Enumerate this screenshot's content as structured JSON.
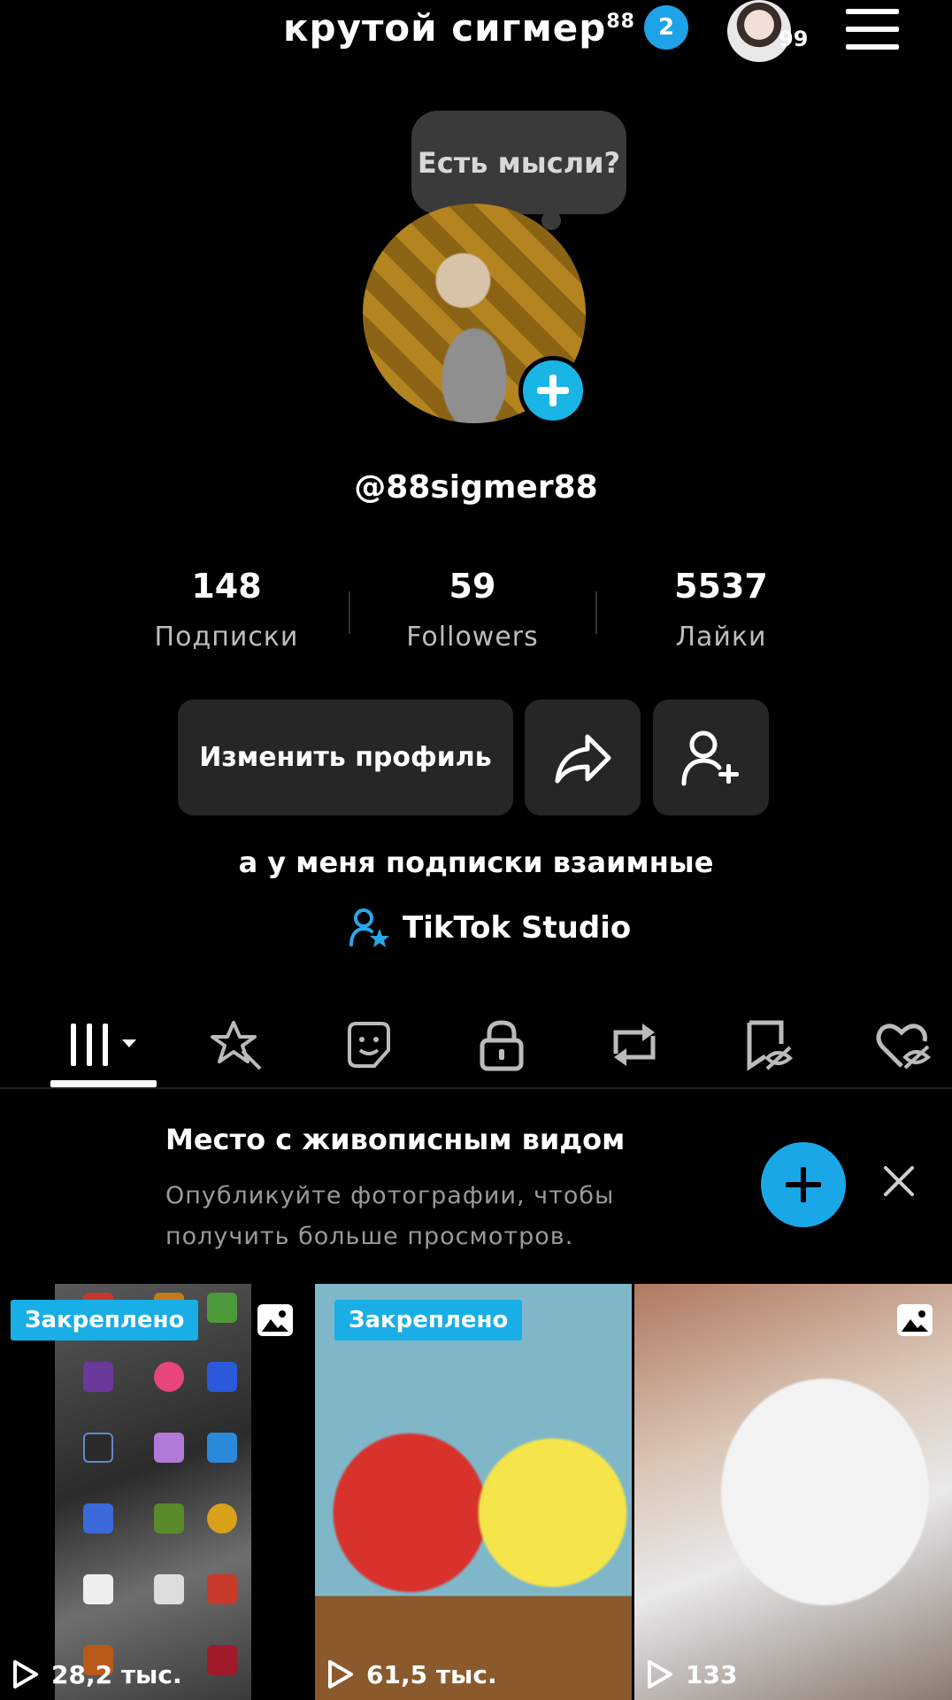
{
  "header": {
    "title": "крутой сигмер",
    "title_sup": "88",
    "notification_count": "2",
    "avatar_count": "99"
  },
  "profile": {
    "thought_prompt": "Есть мысли?",
    "handle": "@88sigmer88",
    "stats": [
      {
        "value": "148",
        "label": "Подписки"
      },
      {
        "value": "59",
        "label": "Followers"
      },
      {
        "value": "5537",
        "label": "Лайки"
      }
    ],
    "edit_profile_label": "Изменить профиль",
    "bio": "а у меня подписки взаимные",
    "studio_label": "TikTok Studio"
  },
  "tabs": [
    {
      "icon": "videos-grid-icon",
      "active": true
    },
    {
      "icon": "sparkle-icon",
      "active": false
    },
    {
      "icon": "sticker-icon",
      "active": false
    },
    {
      "icon": "lock-icon",
      "active": false
    },
    {
      "icon": "repost-icon",
      "active": false
    },
    {
      "icon": "bookmark-hidden-icon",
      "active": false
    },
    {
      "icon": "liked-hidden-icon",
      "active": false
    }
  ],
  "promo": {
    "title": "Место с живописным видом",
    "text": "Опубликуйте фотографии, чтобы получить больше просмотров."
  },
  "videos": [
    {
      "pinned": "Закреплено",
      "views": "28,2 тыс.",
      "photo": true
    },
    {
      "pinned": "Закреплено",
      "views": "61,5 тыс.",
      "photo": false
    },
    {
      "pinned": "",
      "views": "133",
      "photo": true
    }
  ],
  "colors": {
    "accent": "#1fa3e8",
    "background": "#000000",
    "button": "#262626"
  }
}
